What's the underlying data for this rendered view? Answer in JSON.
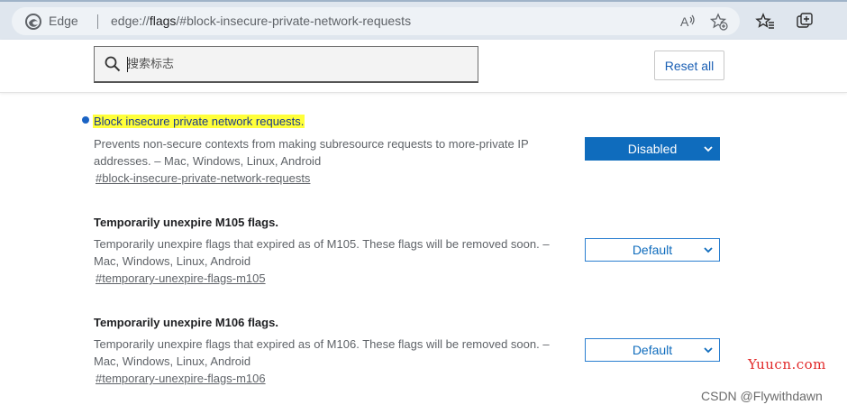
{
  "browser": {
    "brand": "Edge",
    "url_scheme": "edge://",
    "url_host": "flags",
    "url_path": "/#block-insecure-private-network-requests",
    "icons": [
      "edge-logo-icon",
      "read-aloud-icon",
      "add-favorite-icon",
      "favorites-icon",
      "collections-icon"
    ]
  },
  "search": {
    "placeholder": "搜索标志",
    "value": ""
  },
  "reset_button": {
    "label": "Reset all"
  },
  "flags": [
    {
      "title": "Block insecure private network requests.",
      "description": "Prevents non-secure contexts from making subresource requests to more-private IP addresses. – Mac, Windows, Linux, Android",
      "link": "#block-insecure-private-network-requests",
      "selected": "Disabled",
      "highlighted": true
    },
    {
      "title": "Temporarily unexpire M105 flags.",
      "description": "Temporarily unexpire flags that expired as of M105. These flags will be removed soon. – Mac, Windows, Linux, Android",
      "link": "#temporary-unexpire-flags-m105",
      "selected": "Default",
      "highlighted": false
    },
    {
      "title": "Temporarily unexpire M106 flags.",
      "description": "Temporarily unexpire flags that expired as of M106. These flags will be removed soon. – Mac, Windows, Linux, Android",
      "link": "#temporary-unexpire-flags-m106",
      "selected": "Default",
      "highlighted": false
    }
  ],
  "watermarks": {
    "site": "Yuucn.com",
    "author": "CSDN @Flywithdawn"
  },
  "colors": {
    "accent": "#0f6cbd",
    "highlight": "#ffff3a",
    "modified_dot": "#1a63c4",
    "watermark_red": "#e22b2b"
  }
}
